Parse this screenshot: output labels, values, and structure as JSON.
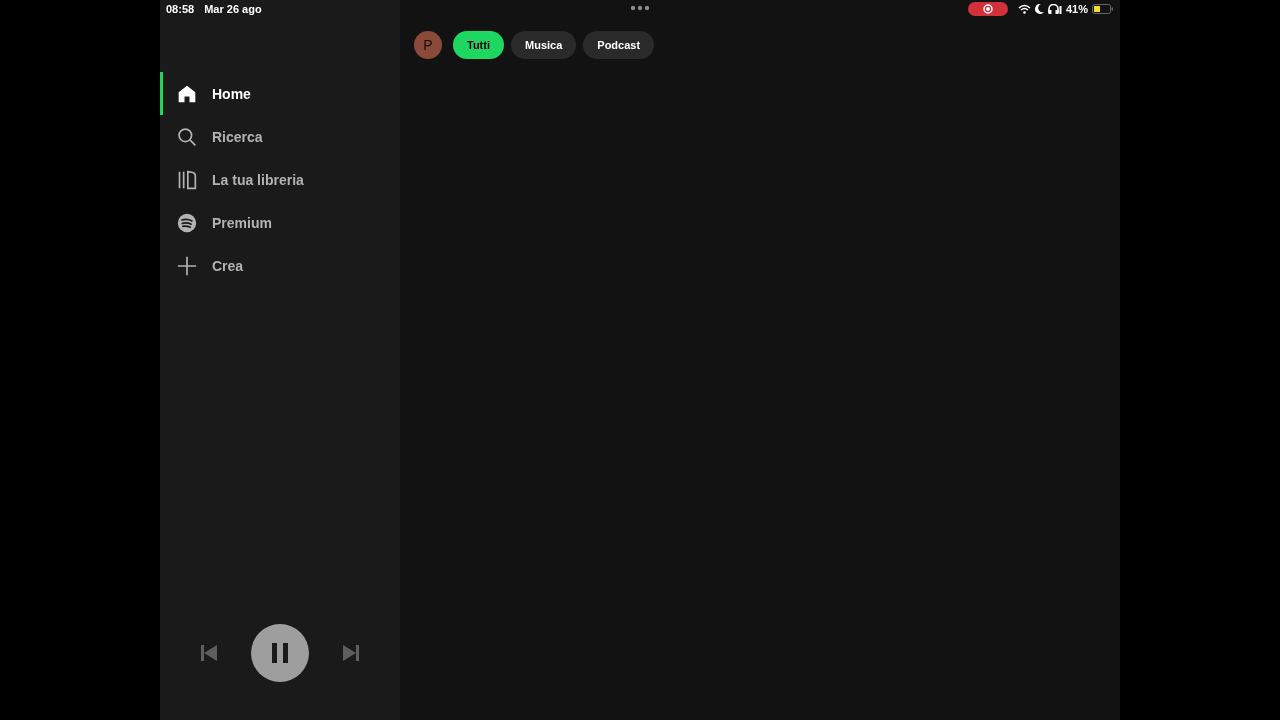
{
  "status_bar": {
    "time": "08:58",
    "date": "Mar 26 ago",
    "recording": true,
    "battery": "41%"
  },
  "profile": {
    "initial": "P"
  },
  "filters": [
    {
      "label": "Tutti",
      "selected": true
    },
    {
      "label": "Musica",
      "selected": false
    },
    {
      "label": "Podcast",
      "selected": false
    }
  ],
  "sidebar": {
    "items": [
      {
        "kind": "home",
        "label": "Home",
        "selected": true
      },
      {
        "kind": "search",
        "label": "Ricerca",
        "selected": false
      },
      {
        "kind": "library",
        "label": "La tua libreria",
        "selected": false
      },
      {
        "kind": "premium",
        "label": "Premium",
        "selected": false
      },
      {
        "kind": "create",
        "label": "Crea",
        "selected": false
      }
    ]
  },
  "player": {
    "playing": true
  }
}
